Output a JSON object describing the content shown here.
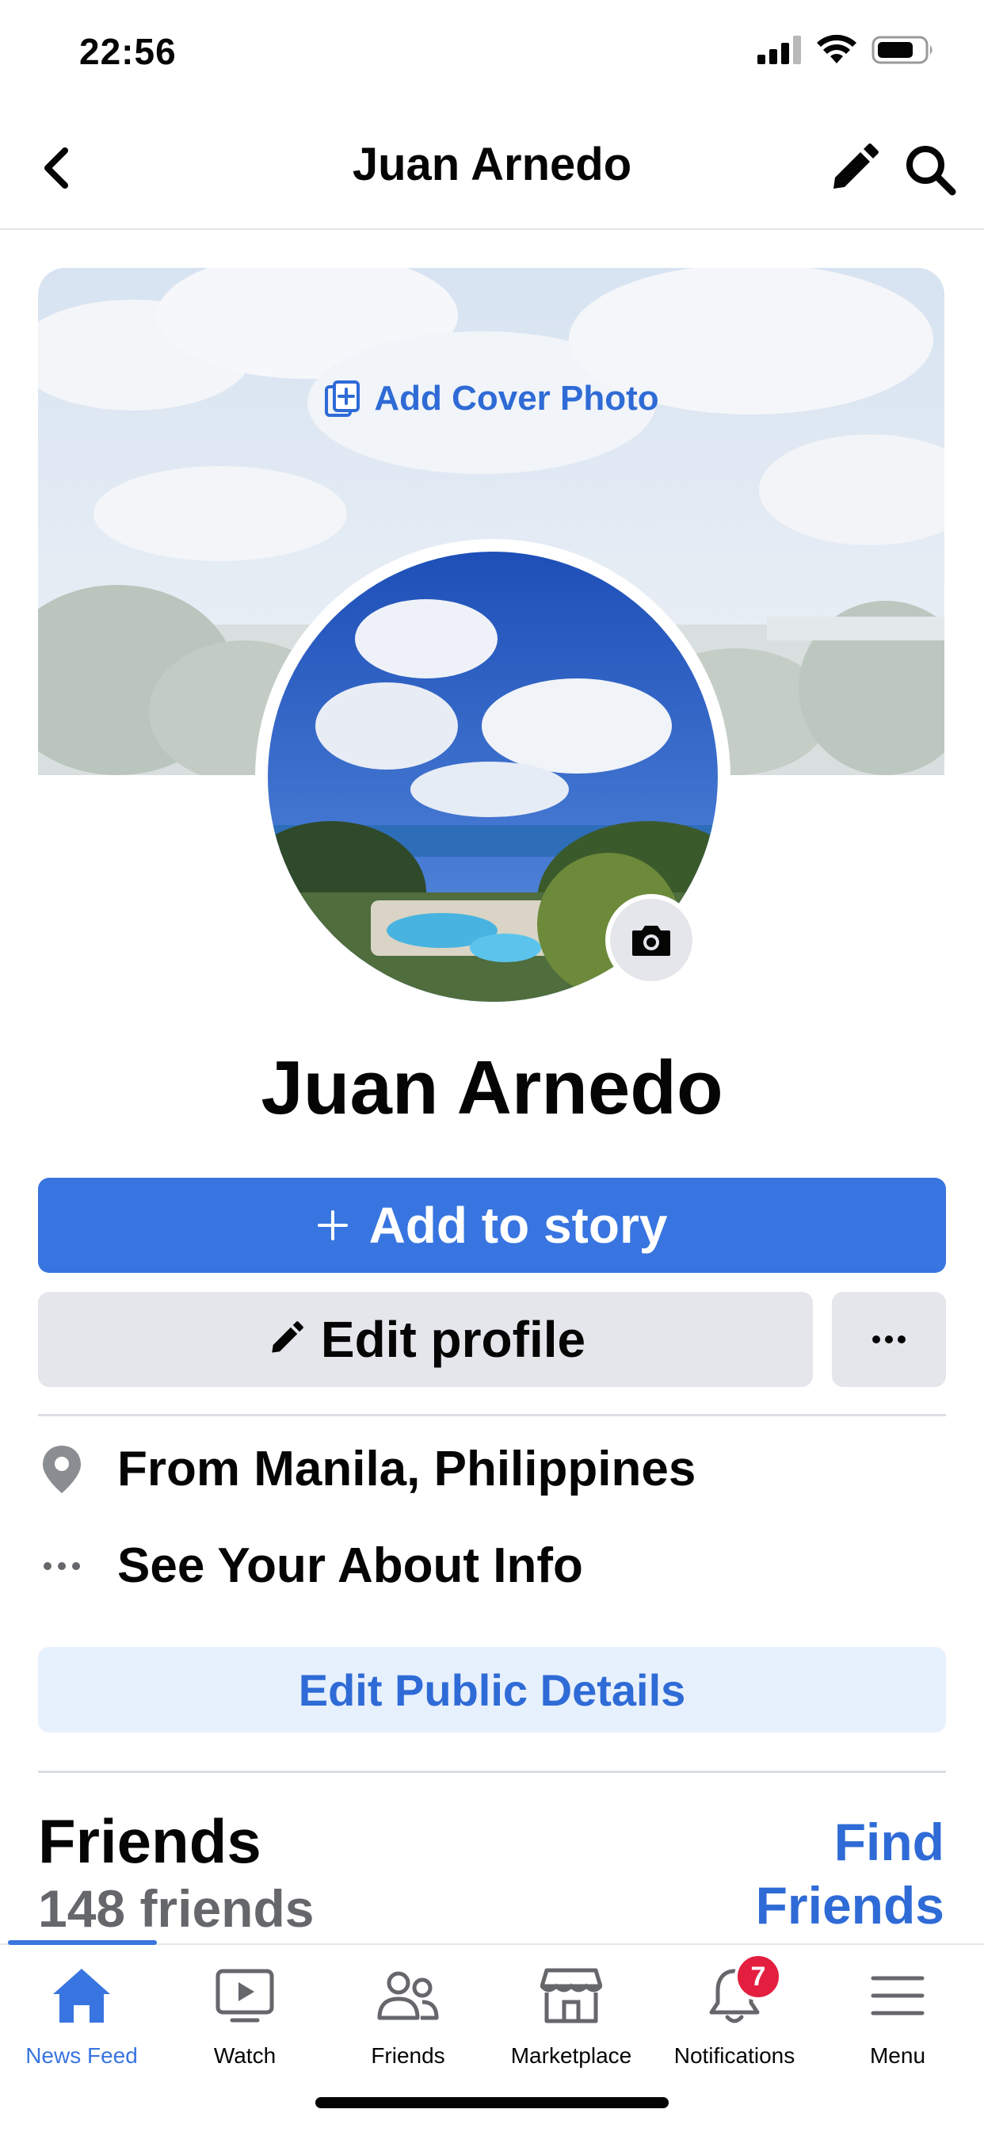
{
  "status_bar": {
    "time": "22:56"
  },
  "nav": {
    "title": "Juan Arnedo"
  },
  "cover": {
    "add_label": "Add Cover Photo"
  },
  "profile": {
    "name": "Juan Arnedo"
  },
  "actions": {
    "add_story_label": "Add to story",
    "edit_profile_label": "Edit profile",
    "more_label": "···"
  },
  "details": {
    "from": "From Manila, Philippines",
    "about": "See Your About Info",
    "edit_public_label": "Edit Public Details"
  },
  "friends": {
    "title": "Friends",
    "count": "148 friends",
    "find_label": "Find Friends"
  },
  "tabbar": {
    "tabs": [
      {
        "label": "News Feed",
        "icon": "home-icon",
        "active": true
      },
      {
        "label": "Watch",
        "icon": "video-icon",
        "active": false
      },
      {
        "label": "Friends",
        "icon": "people-icon",
        "active": false
      },
      {
        "label": "Marketplace",
        "icon": "shop-icon",
        "active": false
      },
      {
        "label": "Notifications",
        "icon": "bell-icon",
        "active": false,
        "badge": "7"
      },
      {
        "label": "Menu",
        "icon": "menu-icon",
        "active": false
      }
    ]
  },
  "colors": {
    "accent": "#3875e0",
    "link": "#2f6bd6",
    "button_gray": "#e4e6eb",
    "badge_red": "#e41e3f"
  }
}
